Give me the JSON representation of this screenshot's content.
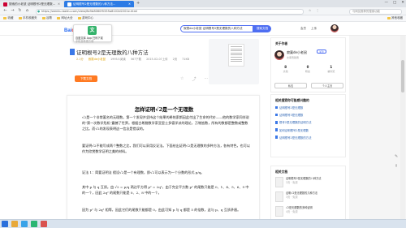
{
  "browser": {
    "tabs": [
      {
        "label": "搜索的小老鼠 证明根号2是无理数..."
      },
      {
        "label": "证明根号2是无理数的八种方法..."
      }
    ],
    "new_tab": "+",
    "window_controls": [
      "—",
      "□",
      "✕"
    ],
    "url": "https://wenku.baidu.com/view/8e5b8060f5335a8102d2201e.html",
    "addr_right": [
      "☆",
      "⋮"
    ],
    "addr_search_placeholder": "与网友推荐的搜索功能",
    "bookmarks": [
      "收藏",
      "手机收藏夹",
      "谷歌",
      "网址大全",
      "游戏中心"
    ],
    "bookmarks_other": "其他收藏"
  },
  "site": {
    "logo_bai": "Bai",
    "logo_du": "du",
    "logo_suffix": "文库",
    "search_value": "寂寞de小老鼠 证明根号2是无理数的八种方法",
    "search_button": "搜索文档",
    "header_links": [
      "会员",
      "上传"
    ]
  },
  "popup": {
    "icon_glyph": "文",
    "line1": "百度文库 App 扫码下载",
    "line2": "手机查看更方便"
  },
  "document": {
    "title": "证明根号2是无理数的八种方法",
    "meta": {
      "vip": "2.1分",
      "user": "寂寞de小老鼠",
      "views": "1995人阅读",
      "downloads": "567下载",
      "date": "2015-02-07上传",
      "pages": "2页",
      "size": "71KB"
    },
    "download_button": "下载文档",
    "action_icons": [
      "☆",
      "⤴",
      "⋯"
    ]
  },
  "page": {
    "heading": "怎样证明√2是一个无理数",
    "p1": "√2是一个非常著名的无理数。第一个发现并坚持这个结果的希帕索斯因此付出了生命的代价——他的数学家同伴说的\"第一次数学危机\"震撼了世界。根据古希腊数学家亚里士多德学派的理论，万物皆数，所有的数都是整数或整数之比。而√2的发现表明这一信念是错误的。",
    "p2": "要证明√2不能写成两个整数之比，我们可以采用反证法。下面给出证明√2是无理数的多种方法，各有特色，也可以作为欣赏数学证明之美的材料。",
    "p3": "证法 1：简要证明法 假设√2是一个有理数，即√2可以表示为一个分数的形式 p/q。",
    "p4": "其中 p 与 q 互质。由 √2 = p/q 两边平方得 p² = 2q²，由于完全平方数 p² 的尾数只能是 0、1、4、5、6、9 中的一个，因此 2q² 的尾数只能是 0、2、8 中的一个。",
    "p5": "因为 p² 与 2q² 相等，因此它们的尾数只能都是 0，由此可知 p 与 q 都是 5 的倍数，这与 p、q 互质矛盾。"
  },
  "sidebar": {
    "author_card_title": "关于作者",
    "author_name": "寂寞de小老鼠",
    "follow": "关注",
    "author_sub": "文库贡献者",
    "stats": [
      {
        "num": "8",
        "lbl": "文档"
      },
      {
        "num": "0",
        "lbl": "粉丝"
      },
      {
        "num": "1",
        "lbl": "被浏览"
      }
    ],
    "author_buttons": [
      "私信",
      "个人主页"
    ],
    "related_title": "相关搜索你可能感兴趣的",
    "related": [
      "证明根号2是无理数",
      "证明根号3是无理数",
      "根号2是无理数的证明方法",
      "如何证明根号2是无理数",
      "证明根号2是无理数的方法"
    ],
    "docs_title": "相关文档",
    "docs": [
      {
        "title": "证明根号2是无理数的八种方法",
        "sub": "2页 · 免费"
      },
      {
        "title": "证明√2是无理数的几种方法",
        "sub": "3页 · 免费"
      },
      {
        "title": "√2是无理数的多种证明",
        "sub": "4页 · 免费"
      }
    ]
  },
  "colors": {
    "brand_blue": "#2468f2",
    "download_orange": "#ff7a22",
    "link_blue": "#2d64b3"
  }
}
